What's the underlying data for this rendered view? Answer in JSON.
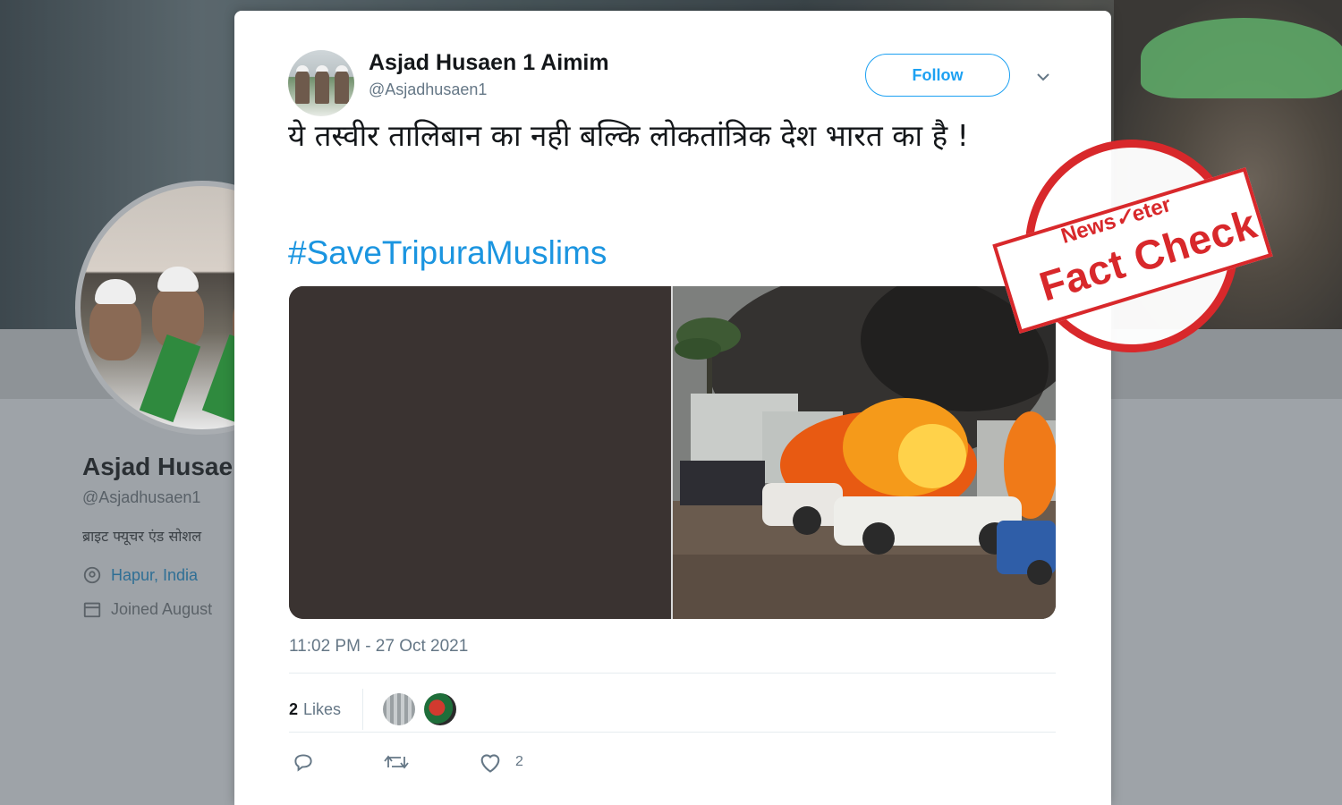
{
  "background_profile": {
    "name": "Asjad Husae",
    "handle": "@Asjadhusaen1",
    "bio": "ब्राइट फ्यूचर एंड सोशल",
    "location": "Hapur, India",
    "joined": "Joined August"
  },
  "tweet": {
    "author_name": "Asjad Husaen 1 Aimim",
    "author_handle": "@Asjadhusaen1",
    "follow_label": "Follow",
    "text": "ये तस्वीर तालिबान का नही बल्कि लोकतांत्रिक देश भारत का है !",
    "hashtag": "#SaveTripuraMuslims",
    "timestamp": "11:02 PM - 27 Oct 2021",
    "likes_count": "2",
    "likes_label": "Likes",
    "like_action_count": "2"
  },
  "stamp": {
    "brand": "NewsMeter",
    "label": "Fact Check",
    "color": "#d8282b"
  },
  "colors": {
    "link_blue": "#1b95e0",
    "follow_blue": "#1da1f2",
    "muted": "#657786"
  }
}
